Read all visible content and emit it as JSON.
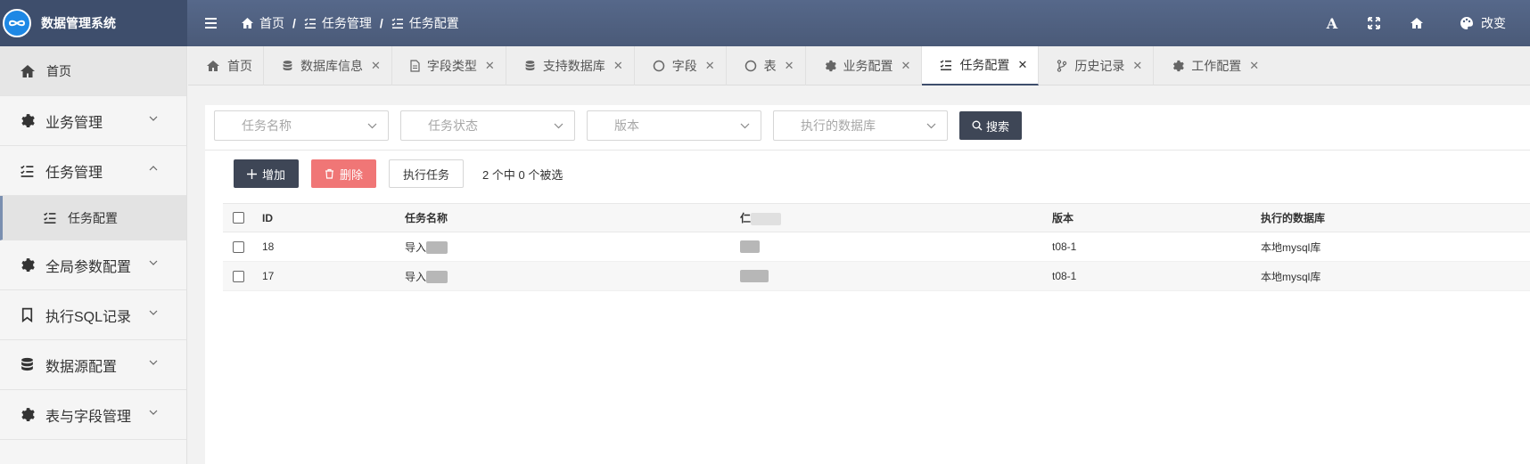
{
  "app": {
    "title": "数据管理系统"
  },
  "breadcrumb": {
    "home": "首页",
    "section": "任务管理",
    "page": "任务配置",
    "sep": "/"
  },
  "toolbar_top": {
    "font_tool": "A",
    "theme_label": "改变"
  },
  "sidebar": {
    "home": "首页",
    "items": [
      {
        "label": "业务管理"
      },
      {
        "label": "任务管理"
      },
      {
        "label": "全局参数配置"
      },
      {
        "label": "执行SQL记录"
      },
      {
        "label": "数据源配置"
      },
      {
        "label": "表与字段管理"
      }
    ],
    "sub_task_config": "任务配置"
  },
  "tabs": [
    {
      "label": "首页",
      "icon": "home-icon"
    },
    {
      "label": "数据库信息",
      "icon": "database-icon"
    },
    {
      "label": "字段类型",
      "icon": "file-icon"
    },
    {
      "label": "支持数据库",
      "icon": "database-icon"
    },
    {
      "label": "字段",
      "icon": "circle-icon"
    },
    {
      "label": "表",
      "icon": "circle-icon"
    },
    {
      "label": "业务配置",
      "icon": "gear-icon"
    },
    {
      "label": "任务配置",
      "icon": "tasklist-icon",
      "active": true
    },
    {
      "label": "历史记录",
      "icon": "branch-icon"
    },
    {
      "label": "工作配置",
      "icon": "gear-icon"
    }
  ],
  "filters": {
    "task_name": "任务名称",
    "task_status": "任务状态",
    "version": "版本",
    "exec_db": "执行的数据库",
    "search": "搜索"
  },
  "actions": {
    "add": "增加",
    "delete": "删除",
    "execute": "执行任务",
    "selection_info": "2 个中 0 个被选"
  },
  "table": {
    "headers": {
      "id": "ID",
      "name": "任务名称",
      "who": "仁",
      "version": "版本",
      "db": "执行的数据库"
    },
    "rows": [
      {
        "id": "18",
        "name": "导入",
        "version": "t08-1",
        "db": "本地mysql库"
      },
      {
        "id": "17",
        "name": "导入",
        "version": "t08-1",
        "db": "本地mysql库"
      }
    ]
  },
  "colors": {
    "header_bg": "#4e5f7f",
    "dark_button": "#3e4656",
    "delete_button": "#f07676",
    "logo_blue": "#1e88e5"
  }
}
